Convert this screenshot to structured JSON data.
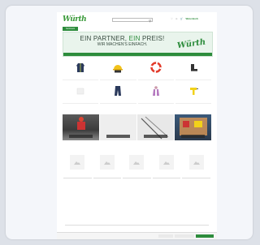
{
  "header": {
    "logo": "Würth",
    "topline": "",
    "search_placeholder": "",
    "icons": [
      "heart-icon",
      "user-icon"
    ],
    "cart_label": "Warenkorb"
  },
  "nav": {
    "items": [
      "Sortiment",
      "",
      ""
    ]
  },
  "banner": {
    "line1_a": "EIN PARTNER, ",
    "line1_b": "EIN",
    "line1_c": " PREIS!",
    "line2": "WIR MACHEN'S EINFACH.",
    "logo": "Würth",
    "subline": ""
  },
  "categories": [
    {
      "label": "",
      "icon": "jacket-icon"
    },
    {
      "label": "",
      "icon": "helmet-icon"
    },
    {
      "label": "",
      "icon": "lifebuoy-icon"
    },
    {
      "label": "",
      "icon": "boot-icon"
    },
    {
      "label": "",
      "icon": "box-icon"
    },
    {
      "label": "",
      "icon": "trousers-icon"
    },
    {
      "label": "",
      "icon": "protective-suit-icon"
    },
    {
      "label": "",
      "icon": "drill-icon"
    }
  ],
  "photos": [
    {
      "caption": ""
    },
    {
      "caption": ""
    },
    {
      "caption": ""
    },
    {
      "caption": ""
    }
  ],
  "products_title": "",
  "products": [
    {
      "name": "",
      "price": ""
    },
    {
      "name": "",
      "price": ""
    },
    {
      "name": "",
      "price": ""
    },
    {
      "name": "",
      "price": ""
    },
    {
      "name": "",
      "price": ""
    }
  ],
  "footer": {
    "cols": [
      {
        "title": "",
        "items": []
      },
      {
        "title": "",
        "items": []
      },
      {
        "title": "",
        "items": []
      }
    ],
    "copyright": ""
  },
  "cookie": {
    "text": "",
    "btn_settings": "",
    "btn_decline": "",
    "btn_accept": ""
  },
  "colors": {
    "brand": "#2d8c3c",
    "banner_bg": "#e9f4ec"
  }
}
